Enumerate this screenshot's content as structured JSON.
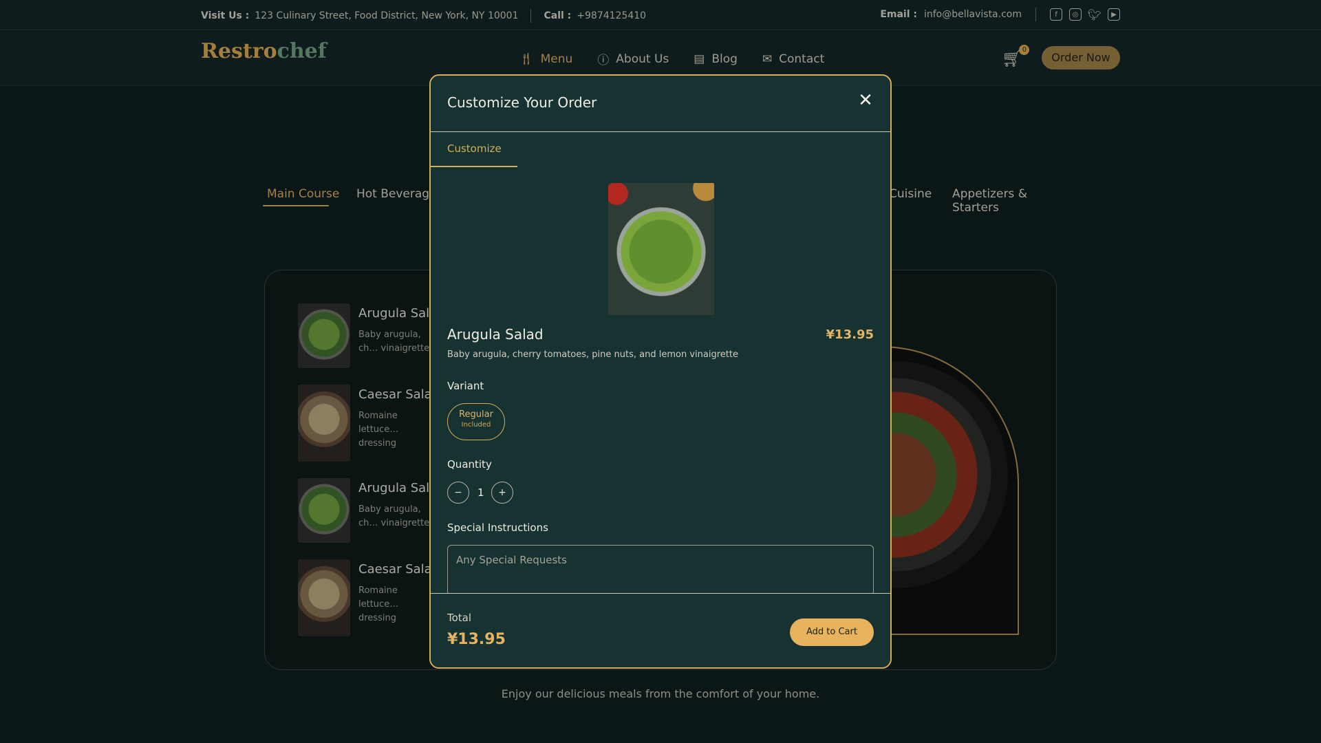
{
  "topbar": {
    "visit_label": "Visit Us :",
    "address": "123 Culinary Street, Food District, New York, NY 10001",
    "call_label": "Call :",
    "phone": "+9874125410",
    "email_label": "Email :",
    "email": "info@bellavista.com",
    "social_icons": [
      "facebook-icon",
      "instagram-icon",
      "twitter-icon",
      "youtube-icon"
    ]
  },
  "brand": {
    "logo_a": "Restro",
    "logo_b": "chef"
  },
  "nav": {
    "items": [
      {
        "label": "Menu",
        "icon": "fork-knife-icon"
      },
      {
        "label": "About Us",
        "icon": "info-icon"
      },
      {
        "label": "Blog",
        "icon": "blog-icon"
      },
      {
        "label": "Contact",
        "icon": "mail-icon"
      }
    ],
    "cart_count": "0",
    "order_button": "Order Now"
  },
  "categories": {
    "main": "Main Course",
    "hot": "Hot Beverages",
    "cuisine": "Cuisine",
    "apps": "Appetizers & Starters"
  },
  "menu_list": [
    {
      "name": "Arugula Salad",
      "desc": "Baby arugula, ch… vinaigrette"
    },
    {
      "name": "Caesar Salad",
      "desc": "Romaine lettuce… dressing"
    },
    {
      "name": "Arugula Salad",
      "desc": "Baby arugula, ch… vinaigrette"
    },
    {
      "name": "Caesar Salad",
      "desc": "Romaine lettuce… dressing"
    }
  ],
  "tagline": "Enjoy our delicious meals from the comfort of your home.",
  "modal": {
    "title": "Customize Your Order",
    "tab": "Customize",
    "item_name": "Arugula Salad",
    "price": "¥13.95",
    "description": "Baby arugula, cherry tomatoes, pine nuts, and lemon vinaigrette",
    "variant_label": "Variant",
    "variant_option": "Regular",
    "variant_sub": "Included",
    "quantity_label": "Quantity",
    "quantity": "1",
    "minus": "−",
    "plus": "+",
    "instructions_label": "Special Instructions",
    "instructions_placeholder": "Any Special Requests",
    "total_label": "Total",
    "total_value": "¥13.95",
    "add_to_cart": "Add to Cart"
  }
}
